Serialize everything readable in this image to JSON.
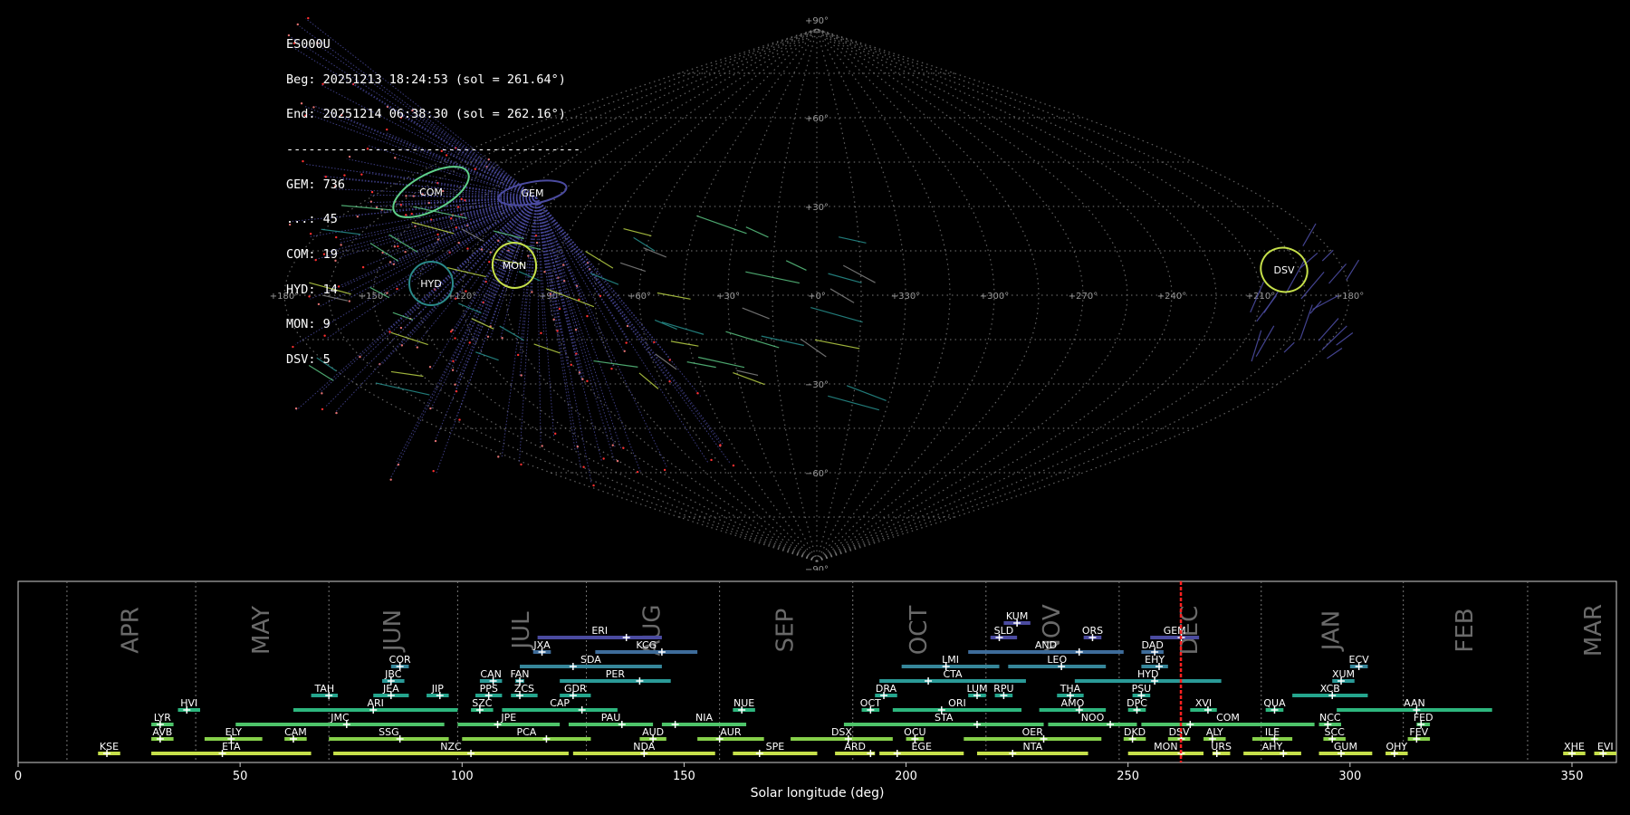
{
  "stats": {
    "station": "ES000U",
    "beg": "Beg: 20251213 18:24:53 (sol = 261.64°)",
    "end": "End: 20251214 06:38:30 (sol = 262.16°)",
    "separator": "----------------------------------------",
    "counts": [
      "GEM: 736",
      "...: 45",
      "COM: 19",
      "HYD: 14",
      "MON: 9",
      "DSV: 5"
    ]
  },
  "chart_data": [
    {
      "type": "scatter",
      "projection": "sinusoidal",
      "description_labels": {
        "lat_labels": [
          "+90°",
          "+60°",
          "+30°",
          "−30°",
          "−60°",
          "−90°"
        ],
        "lon_labels": [
          "+180°",
          "+150°",
          "+120°",
          "+90°",
          "+60°",
          "+30°",
          "+0°",
          "+330°",
          "+300°",
          "+270°",
          "+240°",
          "+210°",
          "+180°"
        ]
      },
      "radiants": [
        {
          "name": "GEM",
          "lon": 113,
          "lat": 33,
          "color": "#4b4ba0",
          "count": 736
        },
        {
          "name": "COM",
          "lon": 155,
          "lat": 30,
          "color": "#5fd08a",
          "count": 19
        },
        {
          "name": "HYD",
          "lon": 153,
          "lat": 2,
          "color": "#2a8a8a",
          "count": 14
        },
        {
          "name": "MON",
          "lon": 110,
          "lat": 10,
          "color": "#c6e04a",
          "count": 9
        },
        {
          "name": "DSV",
          "lon": 258,
          "lat": 7,
          "color": "#c6e04a",
          "count": 5
        }
      ],
      "grid": true
    },
    {
      "type": "timeline",
      "xlabel": "Solar longitude (deg)",
      "xlim": [
        0,
        360
      ],
      "xticks": [
        0,
        50,
        100,
        150,
        200,
        250,
        300,
        350
      ],
      "current_sol": 261.9,
      "months": [
        {
          "name": "APR",
          "start": 11
        },
        {
          "name": "MAY",
          "start": 40
        },
        {
          "name": "JUN",
          "start": 70
        },
        {
          "name": "JUL",
          "start": 99
        },
        {
          "name": "AUG",
          "start": 128
        },
        {
          "name": "SEP",
          "start": 158
        },
        {
          "name": "OCT",
          "start": 188
        },
        {
          "name": "NOV",
          "start": 218
        },
        {
          "name": "DEC",
          "start": 248
        },
        {
          "name": "JAN",
          "start": 280
        },
        {
          "name": "FEB",
          "start": 312
        },
        {
          "name": "MAR",
          "start": 340
        }
      ],
      "showers": [
        {
          "name": "KUM",
          "start": 222,
          "end": 228,
          "peak": 225,
          "row": 9,
          "color": "#4b4ba0"
        },
        {
          "name": "ERI",
          "start": 117,
          "end": 145,
          "peak": 137,
          "row": 8,
          "color": "#4b4ba0"
        },
        {
          "name": "SLD",
          "start": 219,
          "end": 225,
          "peak": 221,
          "row": 8,
          "color": "#4b4ba0"
        },
        {
          "name": "ORS",
          "start": 240,
          "end": 244,
          "peak": 242,
          "row": 8,
          "color": "#4b4ba0"
        },
        {
          "name": "GEM",
          "start": 255,
          "end": 266,
          "peak": 262,
          "row": 8,
          "color": "#4b4ba0"
        },
        {
          "name": "JXA",
          "start": 116,
          "end": 120,
          "peak": 118,
          "row": 7,
          "color": "#3e6c9a"
        },
        {
          "name": "KCG",
          "start": 130,
          "end": 153,
          "peak": 145,
          "row": 7,
          "color": "#3e6c9a"
        },
        {
          "name": "AND",
          "start": 214,
          "end": 249,
          "peak": 239,
          "row": 7,
          "color": "#3e6c9a"
        },
        {
          "name": "DAD",
          "start": 253,
          "end": 258,
          "peak": 256,
          "row": 7,
          "color": "#3e6c9a"
        },
        {
          "name": "COR",
          "start": 84,
          "end": 88,
          "peak": 86,
          "row": 6,
          "color": "#36869a"
        },
        {
          "name": "SDA",
          "start": 113,
          "end": 145,
          "peak": 125,
          "row": 6,
          "color": "#36869a"
        },
        {
          "name": "LMI",
          "start": 199,
          "end": 221,
          "peak": 209,
          "row": 6,
          "color": "#36869a"
        },
        {
          "name": "LEO",
          "start": 223,
          "end": 245,
          "peak": 235,
          "row": 6,
          "color": "#36869a"
        },
        {
          "name": "EHY",
          "start": 253,
          "end": 259,
          "peak": 257,
          "row": 6,
          "color": "#36869a"
        },
        {
          "name": "ECV",
          "start": 300,
          "end": 304,
          "peak": 302,
          "row": 6,
          "color": "#36869a"
        },
        {
          "name": "JBC",
          "start": 82,
          "end": 87,
          "peak": 84,
          "row": 5,
          "color": "#2a9a98"
        },
        {
          "name": "CAN",
          "start": 104,
          "end": 109,
          "peak": 107,
          "row": 5,
          "color": "#2a9a98"
        },
        {
          "name": "FAN",
          "start": 112,
          "end": 114,
          "peak": 113,
          "row": 5,
          "color": "#2a9a98"
        },
        {
          "name": "PER",
          "start": 122,
          "end": 147,
          "peak": 140,
          "row": 5,
          "color": "#2a9a98"
        },
        {
          "name": "CTA",
          "start": 194,
          "end": 227,
          "peak": 205,
          "row": 5,
          "color": "#2a9a98"
        },
        {
          "name": "HYD",
          "start": 238,
          "end": 271,
          "peak": 256,
          "row": 5,
          "color": "#2a9a98"
        },
        {
          "name": "XUM",
          "start": 296,
          "end": 301,
          "peak": 298,
          "row": 5,
          "color": "#2a9a98"
        },
        {
          "name": "TAH",
          "start": 66,
          "end": 72,
          "peak": 70,
          "row": 4,
          "color": "#25a68e"
        },
        {
          "name": "JEA",
          "start": 80,
          "end": 88,
          "peak": 84,
          "row": 4,
          "color": "#25a68e"
        },
        {
          "name": "JIP",
          "start": 92,
          "end": 97,
          "peak": 95,
          "row": 4,
          "color": "#25a68e"
        },
        {
          "name": "PPS",
          "start": 103,
          "end": 109,
          "peak": 106,
          "row": 4,
          "color": "#25a68e"
        },
        {
          "name": "ZCS",
          "start": 111,
          "end": 117,
          "peak": 113,
          "row": 4,
          "color": "#25a68e"
        },
        {
          "name": "GDR",
          "start": 122,
          "end": 129,
          "peak": 125,
          "row": 4,
          "color": "#25a68e"
        },
        {
          "name": "DRA",
          "start": 193,
          "end": 198,
          "peak": 195,
          "row": 4,
          "color": "#25a68e"
        },
        {
          "name": "LUM",
          "start": 214,
          "end": 218,
          "peak": 216,
          "row": 4,
          "color": "#25a68e"
        },
        {
          "name": "RPU",
          "start": 220,
          "end": 224,
          "peak": 222,
          "row": 4,
          "color": "#25a68e"
        },
        {
          "name": "THA",
          "start": 234,
          "end": 240,
          "peak": 237,
          "row": 4,
          "color": "#25a68e"
        },
        {
          "name": "PSU",
          "start": 251,
          "end": 255,
          "peak": 253,
          "row": 4,
          "color": "#25a68e"
        },
        {
          "name": "XCB",
          "start": 287,
          "end": 304,
          "peak": 296,
          "row": 4,
          "color": "#25a68e"
        },
        {
          "name": "HVI",
          "start": 36,
          "end": 41,
          "peak": 38,
          "row": 3,
          "color": "#2db67e"
        },
        {
          "name": "ARI",
          "start": 62,
          "end": 99,
          "peak": 80,
          "row": 3,
          "color": "#2db67e"
        },
        {
          "name": "SZC",
          "start": 102,
          "end": 107,
          "peak": 104,
          "row": 3,
          "color": "#2db67e"
        },
        {
          "name": "CAP",
          "start": 109,
          "end": 135,
          "peak": 127,
          "row": 3,
          "color": "#2db67e"
        },
        {
          "name": "NUE",
          "start": 161,
          "end": 166,
          "peak": 163,
          "row": 3,
          "color": "#2db67e"
        },
        {
          "name": "OCT",
          "start": 190,
          "end": 194,
          "peak": 192,
          "row": 3,
          "color": "#2db67e"
        },
        {
          "name": "ORI",
          "start": 197,
          "end": 226,
          "peak": 208,
          "row": 3,
          "color": "#2db67e"
        },
        {
          "name": "AMO",
          "start": 230,
          "end": 245,
          "peak": 239,
          "row": 3,
          "color": "#2db67e"
        },
        {
          "name": "DPC",
          "start": 250,
          "end": 254,
          "peak": 252,
          "row": 3,
          "color": "#2db67e"
        },
        {
          "name": "XVI",
          "start": 264,
          "end": 270,
          "peak": 268,
          "row": 3,
          "color": "#2db67e"
        },
        {
          "name": "QUA",
          "start": 281,
          "end": 285,
          "peak": 283,
          "row": 3,
          "color": "#2db67e"
        },
        {
          "name": "AAN",
          "start": 297,
          "end": 332,
          "peak": 315,
          "row": 3,
          "color": "#2db67e"
        },
        {
          "name": "LYR",
          "start": 30,
          "end": 35,
          "peak": 32,
          "row": 2,
          "color": "#4ec46a"
        },
        {
          "name": "JMC",
          "start": 49,
          "end": 96,
          "peak": 74,
          "row": 2,
          "color": "#4ec46a"
        },
        {
          "name": "JPE",
          "start": 99,
          "end": 122,
          "peak": 108,
          "row": 2,
          "color": "#4ec46a"
        },
        {
          "name": "PAU",
          "start": 124,
          "end": 143,
          "peak": 136,
          "row": 2,
          "color": "#4ec46a"
        },
        {
          "name": "NIA",
          "start": 145,
          "end": 164,
          "peak": 148,
          "row": 2,
          "color": "#4ec46a"
        },
        {
          "name": "STA",
          "start": 186,
          "end": 231,
          "peak": 216,
          "row": 2,
          "color": "#4ec46a"
        },
        {
          "name": "NOO",
          "start": 232,
          "end": 252,
          "peak": 246,
          "row": 2,
          "color": "#4ec46a"
        },
        {
          "name": "COM",
          "start": 253,
          "end": 292,
          "peak": 264,
          "row": 2,
          "color": "#4ec46a"
        },
        {
          "name": "NCC",
          "start": 293,
          "end": 298,
          "peak": 295,
          "row": 2,
          "color": "#4ec46a"
        },
        {
          "name": "FED",
          "start": 315,
          "end": 318,
          "peak": 316,
          "row": 2,
          "color": "#4ec46a"
        },
        {
          "name": "AVB",
          "start": 30,
          "end": 35,
          "peak": 32,
          "row": 1,
          "color": "#86d04a"
        },
        {
          "name": "ELY",
          "start": 42,
          "end": 55,
          "peak": 48,
          "row": 1,
          "color": "#86d04a"
        },
        {
          "name": "CAM",
          "start": 60,
          "end": 65,
          "peak": 62,
          "row": 1,
          "color": "#86d04a"
        },
        {
          "name": "SSG",
          "start": 70,
          "end": 97,
          "peak": 86,
          "row": 1,
          "color": "#86d04a"
        },
        {
          "name": "PCA",
          "start": 100,
          "end": 129,
          "peak": 119,
          "row": 1,
          "color": "#86d04a"
        },
        {
          "name": "AUD",
          "start": 140,
          "end": 146,
          "peak": 143,
          "row": 1,
          "color": "#86d04a"
        },
        {
          "name": "AUR",
          "start": 153,
          "end": 168,
          "peak": 158,
          "row": 1,
          "color": "#86d04a"
        },
        {
          "name": "DSX",
          "start": 174,
          "end": 197,
          "peak": 187,
          "row": 1,
          "color": "#86d04a"
        },
        {
          "name": "OCU",
          "start": 200,
          "end": 204,
          "peak": 202,
          "row": 1,
          "color": "#86d04a"
        },
        {
          "name": "OER",
          "start": 213,
          "end": 244,
          "peak": 231,
          "row": 1,
          "color": "#86d04a"
        },
        {
          "name": "DKD",
          "start": 249,
          "end": 254,
          "peak": 251,
          "row": 1,
          "color": "#86d04a"
        },
        {
          "name": "DSV",
          "start": 259,
          "end": 264,
          "peak": 262,
          "row": 1,
          "color": "#86d04a"
        },
        {
          "name": "ALY",
          "start": 267,
          "end": 272,
          "peak": 269,
          "row": 1,
          "color": "#86d04a"
        },
        {
          "name": "ILE",
          "start": 278,
          "end": 287,
          "peak": 283,
          "row": 1,
          "color": "#86d04a"
        },
        {
          "name": "SCC",
          "start": 294,
          "end": 299,
          "peak": 296,
          "row": 1,
          "color": "#86d04a"
        },
        {
          "name": "FEV",
          "start": 313,
          "end": 318,
          "peak": 315,
          "row": 1,
          "color": "#86d04a"
        },
        {
          "name": "KSE",
          "start": 18,
          "end": 23,
          "peak": 20,
          "row": 0,
          "color": "#c6e04a"
        },
        {
          "name": "ETA",
          "start": 30,
          "end": 66,
          "peak": 46,
          "row": 0,
          "color": "#c6e04a"
        },
        {
          "name": "NZC",
          "start": 71,
          "end": 124,
          "peak": 102,
          "row": 0,
          "color": "#c6e04a"
        },
        {
          "name": "NDA",
          "start": 125,
          "end": 157,
          "peak": 141,
          "row": 0,
          "color": "#c6e04a"
        },
        {
          "name": "SPE",
          "start": 161,
          "end": 180,
          "peak": 167,
          "row": 0,
          "color": "#c6e04a"
        },
        {
          "name": "ARD",
          "start": 184,
          "end": 193,
          "peak": 192,
          "row": 0,
          "color": "#c6e04a"
        },
        {
          "name": "EGE",
          "start": 194,
          "end": 213,
          "peak": 198,
          "row": 0,
          "color": "#c6e04a"
        },
        {
          "name": "NTA",
          "start": 216,
          "end": 241,
          "peak": 224,
          "row": 0,
          "color": "#c6e04a"
        },
        {
          "name": "MON",
          "start": 250,
          "end": 267,
          "peak": 262,
          "row": 0,
          "color": "#c6e04a"
        },
        {
          "name": "URS",
          "start": 269,
          "end": 273,
          "peak": 270,
          "row": 0,
          "color": "#c6e04a"
        },
        {
          "name": "AHY",
          "start": 276,
          "end": 289,
          "peak": 285,
          "row": 0,
          "color": "#c6e04a"
        },
        {
          "name": "GUM",
          "start": 293,
          "end": 305,
          "peak": 298,
          "row": 0,
          "color": "#c6e04a"
        },
        {
          "name": "OHY",
          "start": 308,
          "end": 313,
          "peak": 310,
          "row": 0,
          "color": "#c6e04a"
        },
        {
          "name": "XHE",
          "start": 348,
          "end": 353,
          "peak": 350,
          "row": 0,
          "color": "#c6e04a"
        },
        {
          "name": "EVI",
          "start": 355,
          "end": 360,
          "peak": 357,
          "row": 0,
          "color": "#c6e04a"
        }
      ]
    }
  ]
}
